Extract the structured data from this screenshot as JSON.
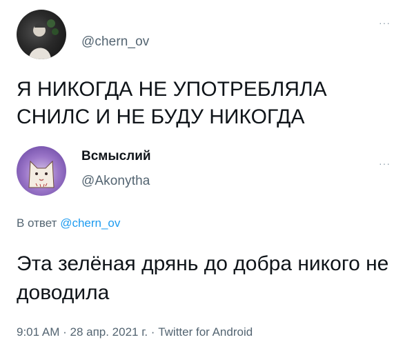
{
  "tweet1": {
    "handle": "@chern_ov",
    "more_label": "···",
    "text": "Я НИКОГДА НЕ УПОТРЕБЛЯЛА СНИЛС И НЕ БУДУ НИКОГДА"
  },
  "tweet2": {
    "display_name": "Всмыслий",
    "handle": "@Akonytha",
    "more_label": "···",
    "reply_prefix": "В ответ",
    "reply_handle": "@chern_ov",
    "text": "Эта зелёная дрянь до добра никого не доводила",
    "time": "9:01 AM",
    "separator": " · ",
    "date": "28 апр. 2021 г.",
    "source": "Twitter for Android"
  },
  "colors": {
    "text": "#0f1419",
    "secondary": "#536471",
    "link": "#1d9bf0"
  },
  "icons": {
    "avatar1": "person-photo",
    "avatar2": "cat-drawing",
    "more": "more-dots-icon"
  }
}
